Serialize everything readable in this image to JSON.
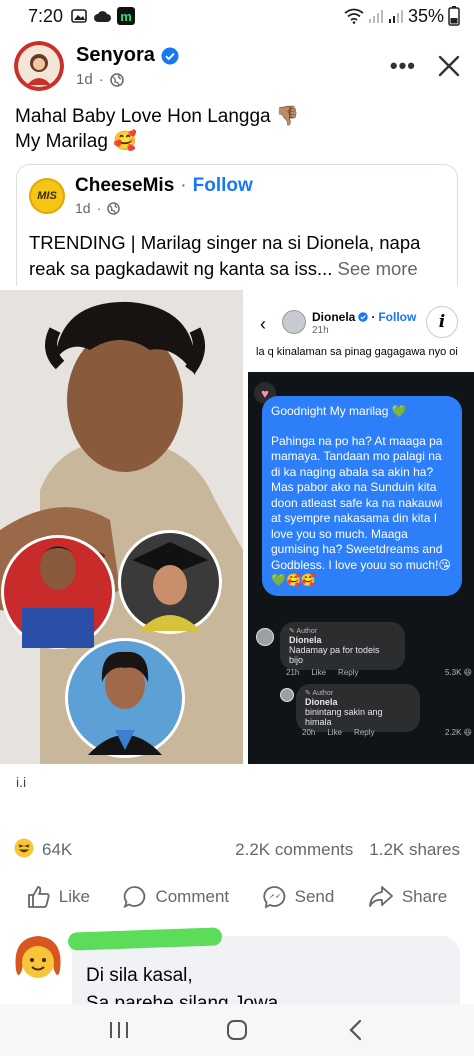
{
  "status_bar": {
    "time": "7:20",
    "battery": "35%"
  },
  "post": {
    "author": "Senyora",
    "time": "1d",
    "text_line1": "Mahal Baby Love Hon Langga 👎🏽",
    "text_line2": "My Marilag 🥰"
  },
  "shared": {
    "avatar_text": "MIS",
    "author": "CheeseMis",
    "separator": "·",
    "follow_label": "Follow",
    "time": "1d",
    "text": "TRENDING | Marilag singer na si Dionela, napa reak sa pagkadawit ng kanta sa iss...",
    "see_more": "See more"
  },
  "screenshot": {
    "back": "‹",
    "name": "Dionela",
    "separator": "·",
    "follow_label": "Follow",
    "time": "21h",
    "info": "i",
    "caption": "la q kinalaman sa pinag gagagawa nyo oi",
    "heart": "♥",
    "message_p1": "Goodnight My marilag 💚",
    "message_p2": "Pahinga na po ha? At maaga pa mamaya. Tandaan mo palagi na di ka naging abala sa akin ha? Mas pabor ako na Sunduin kita doon atleast safe ka na nakauwi at syempre nakasama din kita I love you so much. Maaga gumising ha? Sweetdreams and Godbless. I love youu so much!😘💚🥰🥰",
    "comments": [
      {
        "author_tag": "✎ Author",
        "name": "Dionela",
        "text": "Nadamay pa for todeis bijo",
        "time": "21h",
        "like": "Like",
        "reply": "Reply",
        "reactions": "5.3K 😆"
      },
      {
        "author_tag": "✎ Author",
        "name": "Dionela",
        "text": "binintang sakin ang himala",
        "time": "20h",
        "like": "Like",
        "reply": "Reply",
        "reactions": "2.2K 😆"
      }
    ]
  },
  "below_image_text": "i.i",
  "stats": {
    "reaction_count": "64K",
    "comments": "2.2K comments",
    "shares": "1.2K shares"
  },
  "actions": {
    "like": "Like",
    "comment": "Comment",
    "send": "Send",
    "share": "Share"
  },
  "comment_preview": {
    "line1": "Di sila kasal,",
    "line2": "Sa parehe silang Jowa"
  },
  "colors": {
    "accent": "#1877f2",
    "message_bubble": "#2d7ff9",
    "dark_panel": "#111416",
    "scribble": "#5ddc5a"
  }
}
